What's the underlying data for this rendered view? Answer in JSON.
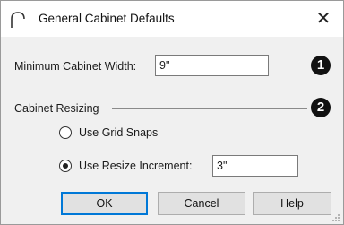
{
  "window": {
    "title": "General Cabinet Defaults",
    "close_glyph": "✕"
  },
  "min_width": {
    "label": "Minimum Cabinet Width:",
    "value": "9\"",
    "badge": "1"
  },
  "resizing": {
    "group_label": "Cabinet Resizing",
    "badge": "2",
    "options": [
      {
        "label": "Use Grid Snaps",
        "selected": false
      },
      {
        "label": "Use Resize Increment:",
        "selected": true
      }
    ],
    "increment_value": "3\""
  },
  "buttons": {
    "ok": "OK",
    "cancel": "Cancel",
    "help": "Help"
  },
  "colors": {
    "accent": "#0078d7",
    "dialog_bg": "#f0f0f0",
    "badge_bg": "#111111"
  },
  "icons": {
    "app": "cabinet-arch-icon",
    "close": "close-icon",
    "radio_unchecked": "radio-unchecked-icon",
    "radio_checked": "radio-checked-icon",
    "resize_grip": "resize-grip-icon"
  }
}
